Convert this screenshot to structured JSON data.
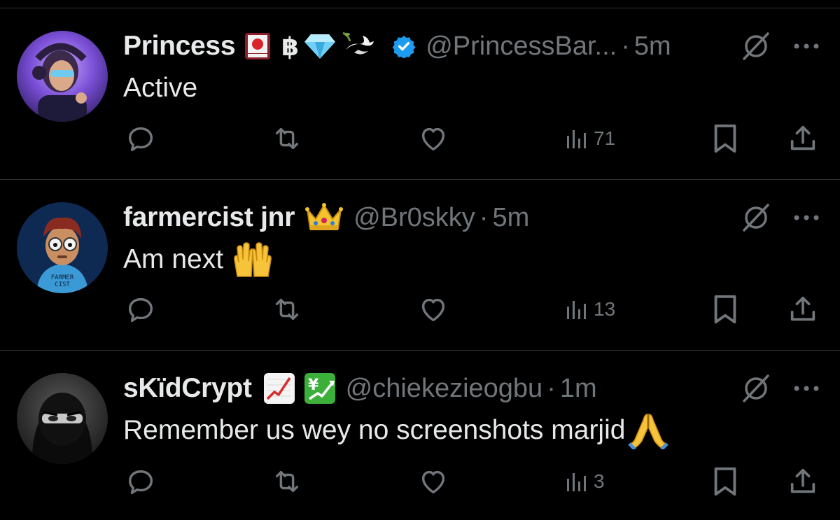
{
  "colors": {
    "background": "#000000",
    "text": "#e7e9ea",
    "muted": "#71767b",
    "divider": "#2f3336",
    "verified": "#1d9bf0"
  },
  "tweets": [
    {
      "name": "Princess",
      "name_emojis": [
        "flag-card-icon",
        "bitcoin-icon",
        "diamond-icon",
        "dove-icon"
      ],
      "verified": true,
      "handle": "@PrincessBar...",
      "separator": "·",
      "time": "5m",
      "text": "Active",
      "text_emoji": "",
      "views": "71"
    },
    {
      "name": "farmercist jnr",
      "name_emojis": [
        "crown-icon"
      ],
      "verified": false,
      "handle": "@Br0skky",
      "separator": "·",
      "time": "5m",
      "text": "Am next",
      "text_emoji": "raising-hands-icon",
      "views": "13"
    },
    {
      "name": "sKïdCrypt",
      "name_emojis": [
        "chart-up-icon",
        "yen-chart-icon"
      ],
      "verified": false,
      "handle": "@chiekezieogbu",
      "separator": "·",
      "time": "1m",
      "text": "Remember us wey no screenshots marjid",
      "text_emoji": "folded-hands-icon",
      "views": "3"
    }
  ]
}
